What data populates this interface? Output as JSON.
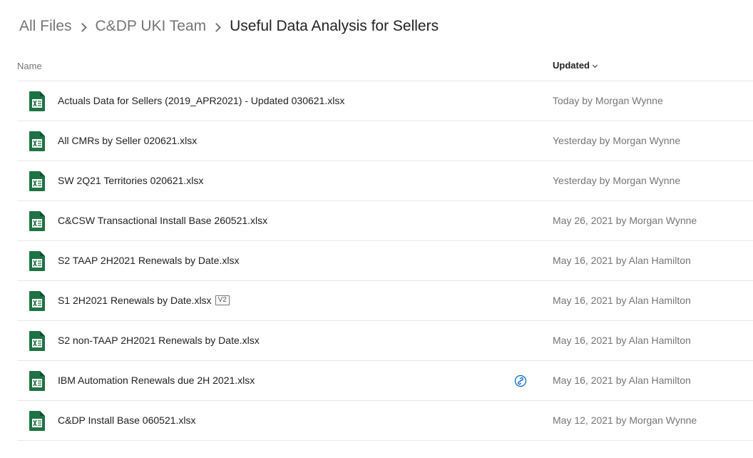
{
  "breadcrumb": {
    "items": [
      "All Files",
      "C&DP UKI Team"
    ],
    "current": "Useful Data Analysis for Sellers"
  },
  "columns": {
    "name": "Name",
    "updated": "Updated"
  },
  "accent_color": "#0061d5",
  "excel_icon_color": "#1f7244",
  "files": [
    {
      "name": "Actuals Data for Sellers (2019_APR2021) - Updated 030621.xlsx",
      "updated": "Today by Morgan Wynne",
      "icon": "excel-file-icon"
    },
    {
      "name": "All CMRs by Seller 020621.xlsx",
      "updated": "Yesterday by Morgan Wynne",
      "icon": "excel-file-icon"
    },
    {
      "name": "SW 2Q21 Territories 020621.xlsx",
      "updated": "Yesterday by Morgan Wynne",
      "icon": "excel-file-icon"
    },
    {
      "name": "C&CSW Transactional Install Base 260521.xlsx",
      "updated": "May 26, 2021 by Morgan Wynne",
      "icon": "excel-file-icon"
    },
    {
      "name": "S2 TAAP 2H2021 Renewals by Date.xlsx",
      "updated": "May 16, 2021 by Alan Hamilton",
      "icon": "excel-file-icon"
    },
    {
      "name": "S1 2H2021 Renewals by Date.xlsx",
      "version": "V2",
      "updated": "May 16, 2021 by Alan Hamilton",
      "icon": "excel-file-icon"
    },
    {
      "name": "S2 non-TAAP 2H2021 Renewals by Date.xlsx",
      "updated": "May 16, 2021 by Alan Hamilton",
      "icon": "excel-file-icon"
    },
    {
      "name": "IBM Automation Renewals due 2H 2021.xlsx",
      "updated": "May 16, 2021 by Alan Hamilton",
      "shared_link": true,
      "icon": "excel-file-icon"
    },
    {
      "name": "C&DP Install Base 060521.xlsx",
      "updated": "May 12, 2021 by Morgan Wynne",
      "icon": "excel-file-icon"
    }
  ]
}
